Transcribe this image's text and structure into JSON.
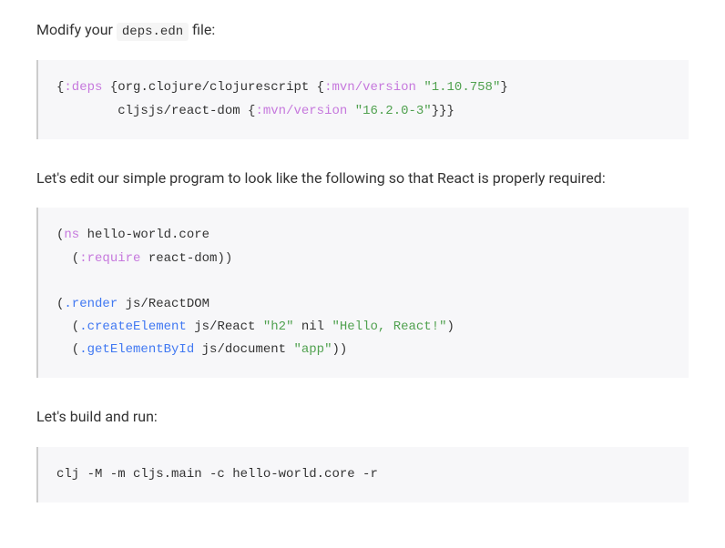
{
  "para1_before": "Modify your ",
  "para1_code": "deps.edn",
  "para1_after": " file:",
  "code1": {
    "indent1": "{",
    "kw_deps": ":deps",
    "sp1": " {",
    "sym_cljs": "org.clojure/clojurescript",
    "sp2": " {",
    "kw_mvn1": ":mvn/version",
    "sp3": " ",
    "str_v1": "\"1.10.758\"",
    "end1": "}",
    "line2_indent": "        ",
    "sym_reactdom": "cljsjs/react-dom",
    "sp4": " {",
    "kw_mvn2": ":mvn/version",
    "sp5": " ",
    "str_v2": "\"16.2.0-3\"",
    "end2": "}}}"
  },
  "para2": "Let's edit our simple program to look like the following so that React is properly required:",
  "code2": {
    "l1_a": "(",
    "l1_ns": "ns",
    "l1_b": " hello-world.core",
    "l2_a": "  (",
    "l2_req": ":require",
    "l2_b": " react-dom))",
    "blank": "",
    "l4_a": "(",
    "l4_render": ".render",
    "l4_b": " js/ReactDOM",
    "l5_a": "  (",
    "l5_create": ".createElement",
    "l5_b": " js/React ",
    "l5_h2": "\"h2\"",
    "l5_c": " nil ",
    "l5_str": "\"Hello, React!\"",
    "l5_d": ")",
    "l6_a": "  (",
    "l6_get": ".getElementById",
    "l6_b": " js/document ",
    "l6_app": "\"app\"",
    "l6_c": "))"
  },
  "para3": "Let's build and run:",
  "code3": "clj -M -m cljs.main -c hello-world.core -r"
}
